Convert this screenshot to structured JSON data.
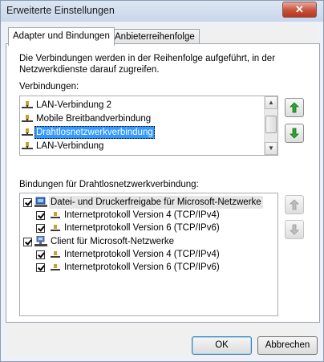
{
  "window": {
    "title": "Erweiterte Einstellungen",
    "close_label": "✕"
  },
  "tabs": [
    {
      "label": "Adapter und Bindungen",
      "active": true
    },
    {
      "label": "Anbieterreihenfolge",
      "active": false
    }
  ],
  "description": "Die Verbindungen werden in der Reihenfolge aufgeführt, in der Netzwerkdienste darauf zugreifen.",
  "connections": {
    "label": "Verbindungen:",
    "items": [
      {
        "label": "LAN-Verbindung 2",
        "selected": false
      },
      {
        "label": "Mobile Breitbandverbindung",
        "selected": false
      },
      {
        "label": "Drahtlosnetzwerkverbindung",
        "selected": true
      },
      {
        "label": "LAN-Verbindung",
        "selected": false
      }
    ]
  },
  "bindings": {
    "label": "Bindungen für Drahtlosnetzwerkverbindung:",
    "items": [
      {
        "label": "Datei- und Druckerfreigabe für Microsoft-Netzwerke",
        "checked": true,
        "level": 0,
        "icon": "printer-share-icon"
      },
      {
        "label": "Internetprotokoll Version 4 (TCP/IPv4)",
        "checked": true,
        "level": 1,
        "icon": "protocol-icon"
      },
      {
        "label": "Internetprotokoll Version 6 (TCP/IPv6)",
        "checked": true,
        "level": 1,
        "icon": "protocol-icon"
      },
      {
        "label": "Client für Microsoft-Netzwerke",
        "checked": true,
        "level": 0,
        "icon": "network-client-icon"
      },
      {
        "label": "Internetprotokoll Version 4 (TCP/IPv4)",
        "checked": true,
        "level": 1,
        "icon": "protocol-icon"
      },
      {
        "label": "Internetprotokoll Version 6 (TCP/IPv6)",
        "checked": true,
        "level": 1,
        "icon": "protocol-icon"
      }
    ]
  },
  "buttons": {
    "ok": "OK",
    "cancel": "Abbrechen"
  },
  "colors": {
    "selection": "#3399ff",
    "arrow_enabled": "#2fa531",
    "arrow_disabled": "#a8a8a8"
  }
}
